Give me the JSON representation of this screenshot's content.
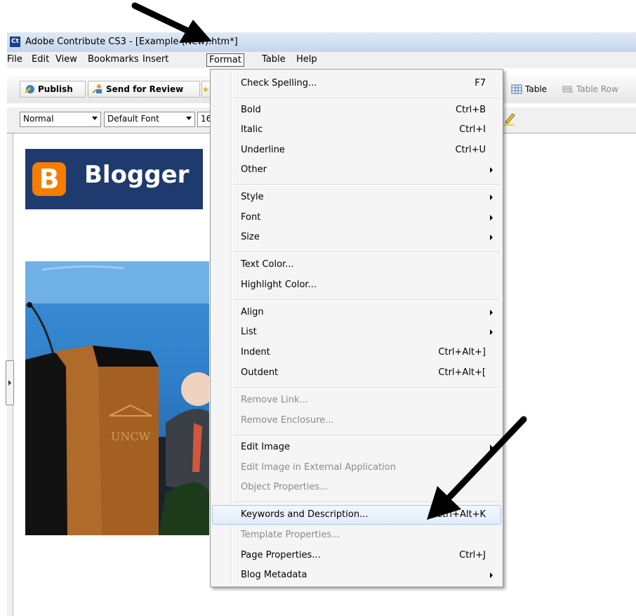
{
  "window": {
    "app_icon_text": "Ct",
    "title": "Adobe Contribute CS3 - [Example (New).htm*]"
  },
  "menubar": [
    "File",
    "Edit",
    "View",
    "Bookmarks",
    "Insert",
    "Format",
    "Table",
    "Help"
  ],
  "toolbar1": {
    "publish": "Publish",
    "send_for_review": "Send for Review",
    "table": "Table",
    "table_row": "Table Row"
  },
  "toolbar2": {
    "style_select": "Normal",
    "font_select": "Default Font",
    "size_select": "16"
  },
  "content": {
    "blogger_letter": "B",
    "blogger_word": "Blogger",
    "podium_text": "UNCW"
  },
  "format_menu": {
    "check_spelling": "Check Spelling...",
    "check_spelling_sc": "F7",
    "bold": "Bold",
    "bold_sc": "Ctrl+B",
    "italic": "Italic",
    "italic_sc": "Ctrl+I",
    "underline": "Underline",
    "underline_sc": "Ctrl+U",
    "other": "Other",
    "style": "Style",
    "font": "Font",
    "size": "Size",
    "text_color": "Text Color...",
    "highlight_color": "Highlight Color...",
    "align": "Align",
    "list": "List",
    "indent": "Indent",
    "indent_sc": "Ctrl+Alt+]",
    "outdent": "Outdent",
    "outdent_sc": "Ctrl+Alt+[",
    "remove_link": "Remove Link...",
    "remove_enclosure": "Remove Enclosure...",
    "edit_image": "Edit Image",
    "edit_image_external": "Edit Image in External Application",
    "object_properties": "Object Properties...",
    "keywords": "Keywords and Description...",
    "keywords_sc": "Ctrl+Alt+K",
    "template_properties": "Template Properties...",
    "page_properties": "Page Properties...",
    "page_properties_sc": "Ctrl+J",
    "blog_metadata": "Blog Metadata"
  },
  "colors": {
    "menu_highlight": "#e2edfa",
    "disabled_text": "#8a8a8a",
    "blogger_orange": "#f57d00",
    "blogger_navy": "#1f3a6e"
  }
}
